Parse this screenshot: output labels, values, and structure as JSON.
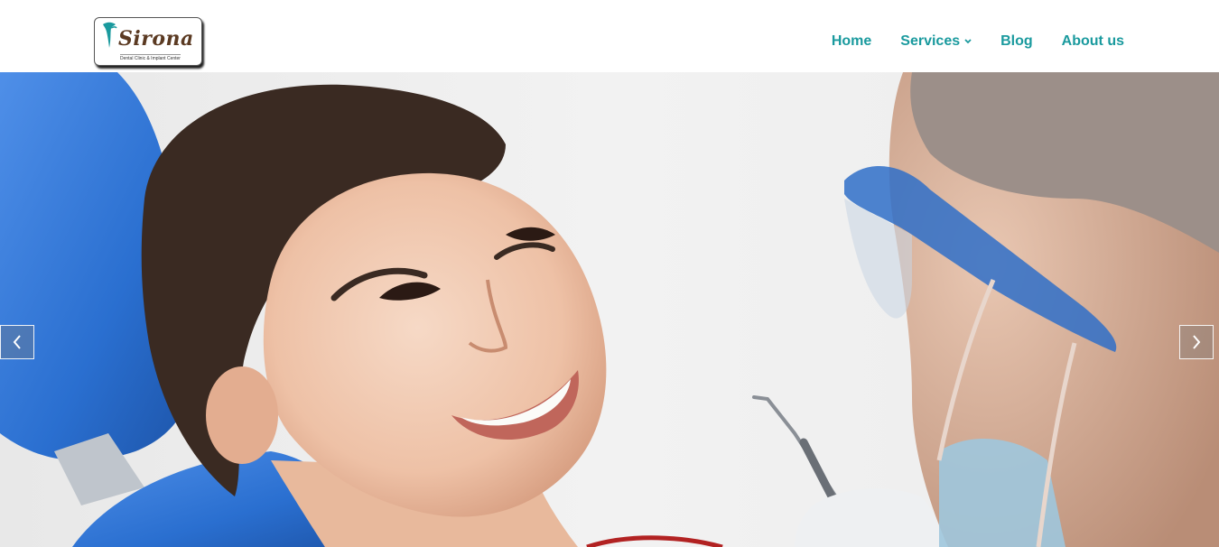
{
  "logo": {
    "name": "Sirona",
    "tagline": "Dental Clinic & Implant Center"
  },
  "nav": {
    "items": [
      {
        "label": "Home"
      },
      {
        "label": "Services",
        "has_dropdown": true
      },
      {
        "label": "Blog"
      },
      {
        "label": "About us"
      }
    ]
  },
  "hero": {
    "image": "smiling-patient-in-dental-chair",
    "prev_icon": "chevron-left-icon",
    "next_icon": "chevron-right-icon"
  },
  "colors": {
    "accent": "#1a9a9e",
    "logo_brown": "#5b3a22",
    "chair_blue": "#2a6fd0"
  }
}
